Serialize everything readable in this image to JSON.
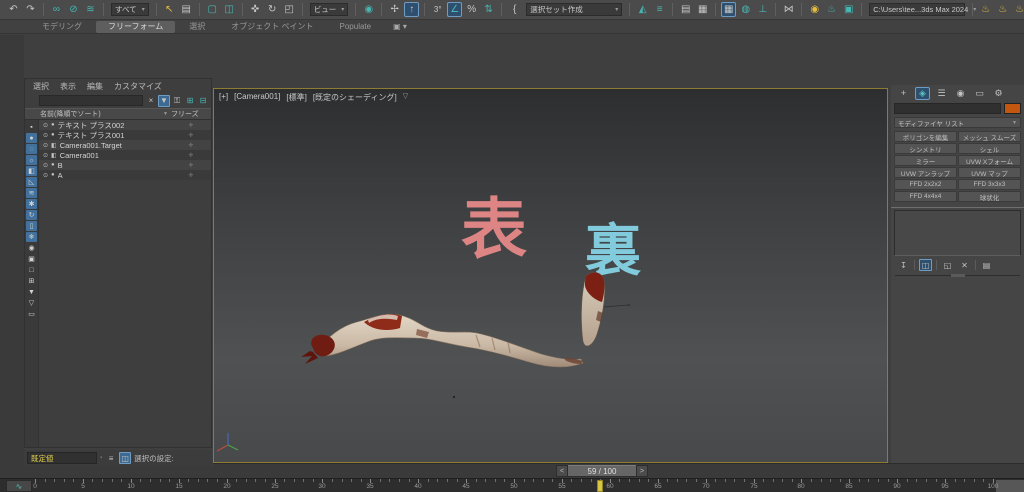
{
  "colors": {
    "accent_blue": "#2e4f6d",
    "teal": "#46b8b4",
    "yellow": "#e4bd3f",
    "swatch_orange": "#c4570f",
    "viewport_border": "#8f7c33",
    "front_text": "#dd8484",
    "back_text": "#82cbdc",
    "marker_yellow": "#d8c643"
  },
  "toolbar": {
    "groups": [
      {
        "items": [
          {
            "name": "undo-icon",
            "glyph": "↶"
          },
          {
            "name": "redo-icon",
            "glyph": "↷"
          }
        ]
      },
      {
        "items": [
          {
            "name": "select-and-link-icon",
            "glyph": "∞",
            "teal": true
          },
          {
            "name": "unlink-selection-icon",
            "glyph": "⊘",
            "teal": true
          },
          {
            "name": "bind-to-space-warp-icon",
            "glyph": "≋",
            "teal": true
          }
        ]
      },
      {
        "items": [
          {
            "name": "selection-filter-dropdown",
            "text": "すべて"
          }
        ]
      },
      {
        "items": [
          {
            "name": "select-object-icon",
            "glyph": "↖",
            "yellow": true
          },
          {
            "name": "select-by-name-icon",
            "glyph": "▤"
          }
        ]
      },
      {
        "items": [
          {
            "name": "rectangular-selection-region-icon",
            "glyph": "▢",
            "teal": true
          },
          {
            "name": "window-crossing-icon",
            "glyph": "◫",
            "teal": true
          }
        ]
      },
      {
        "items": [
          {
            "name": "select-and-move-icon",
            "glyph": "✜"
          },
          {
            "name": "select-and-rotate-icon",
            "glyph": "↻"
          },
          {
            "name": "select-and-scale-icon",
            "glyph": "◰"
          }
        ]
      },
      {
        "items": [
          {
            "name": "reference-coordinate-system-dropdown",
            "text": "ビュー"
          }
        ]
      },
      {
        "items": [
          {
            "name": "use-pivot-point-center-icon",
            "glyph": "◉",
            "teal": true
          }
        ]
      },
      {
        "items": [
          {
            "name": "select-and-manipulate-icon",
            "glyph": "✢"
          },
          {
            "name": "keyboard-shortcut-override-icon",
            "glyph": "↑",
            "active": true
          }
        ]
      },
      {
        "items": [
          {
            "name": "snaps-toggle-icon",
            "glyph": "3°"
          },
          {
            "name": "angle-snap-icon",
            "glyph": "∠",
            "teal": true,
            "active": true
          },
          {
            "name": "percent-snap-icon",
            "glyph": "%"
          },
          {
            "name": "spinner-snap-icon",
            "glyph": "⇅",
            "teal": true
          }
        ]
      },
      {
        "items": [
          {
            "name": "edit-named-selection-sets-icon",
            "glyph": "{"
          },
          {
            "name": "named-selection-sets-dropdown",
            "text": "選択セット作成",
            "wide": true
          }
        ]
      },
      {
        "items": [
          {
            "name": "mirror-icon",
            "glyph": "◭",
            "teal": true
          },
          {
            "name": "align-icon",
            "glyph": "≡",
            "teal": true
          }
        ]
      },
      {
        "items": [
          {
            "name": "toggle-scene-explorer-icon",
            "glyph": "▤"
          },
          {
            "name": "toggle-layer-explorer-icon",
            "glyph": "▦"
          }
        ]
      },
      {
        "items": [
          {
            "name": "viewport-layout-tabs-icon",
            "glyph": "▦",
            "active": true
          },
          {
            "name": "slate-material-editor-icon",
            "glyph": "◍",
            "teal": true
          },
          {
            "name": "curve-editor-icon",
            "glyph": "⊥",
            "teal": true
          }
        ]
      },
      {
        "items": [
          {
            "name": "schematic-view-icon",
            "glyph": "⋈"
          }
        ]
      },
      {
        "items": [
          {
            "name": "material-editor-icon",
            "glyph": "◉",
            "yellow": true
          },
          {
            "name": "render-setup-icon",
            "glyph": "♨",
            "teal": true
          },
          {
            "name": "rendered-frame-window-icon",
            "glyph": "▣",
            "teal": true
          }
        ]
      },
      {
        "items": [
          {
            "name": "project-folder-dropdown",
            "text": "C:\\Users\\tee...3ds Max 2024",
            "wide": true
          }
        ]
      },
      {
        "items": [
          {
            "name": "batch-render-icon",
            "glyph": "♨",
            "yellow": true
          },
          {
            "name": "render-to-texture-icon",
            "glyph": "♨",
            "yellow": true
          },
          {
            "name": "render-iterative-icon",
            "glyph": "♨",
            "yellow": true
          },
          {
            "name": "render-production-icon",
            "glyph": "♨",
            "yellow": true
          }
        ]
      },
      {
        "items": [
          {
            "name": "state-sets-clock-icon",
            "glyph": "◷",
            "active": true
          },
          {
            "name": "check-circle-icon",
            "glyph": "✔",
            "teal": true
          },
          {
            "name": "shutter-circle-icon",
            "glyph": "◎"
          }
        ]
      }
    ]
  },
  "ribbon": {
    "tabs": [
      {
        "name": "tab-modeling",
        "label": "モデリング"
      },
      {
        "name": "tab-freeform",
        "label": "フリーフォーム",
        "active": true
      },
      {
        "name": "tab-selection",
        "label": "選択"
      },
      {
        "name": "tab-object-paint",
        "label": "オブジェクト ペイント"
      },
      {
        "name": "tab-populate",
        "label": "Populate"
      }
    ],
    "config_icon_glyph": "▣",
    "config_arrow": "▾"
  },
  "scene_explorer": {
    "menus": [
      {
        "name": "menu-select",
        "label": "選択"
      },
      {
        "name": "menu-display",
        "label": "表示"
      },
      {
        "name": "menu-edit",
        "label": "編集"
      },
      {
        "name": "menu-customize",
        "label": "カスタマイズ"
      }
    ],
    "search_value": "",
    "search_buttons": [
      {
        "name": "clear-search-icon",
        "glyph": "×"
      },
      {
        "name": "search-filter-icon",
        "glyph": "▼",
        "on": true
      },
      {
        "name": "lock-explorer-icon",
        "glyph": "⚿"
      },
      {
        "name": "expand-all-icon",
        "glyph": "⊞",
        "teal": true
      },
      {
        "name": "collapse-all-icon",
        "glyph": "⊟",
        "teal": true
      }
    ],
    "name_column": "名前(降順でソート)",
    "sort_indicator": "▼",
    "freeze_column": "フリーズ",
    "filter_strip": [
      {
        "name": "explorer-options-icon",
        "glyph": "▪",
        "on": false
      },
      {
        "name": "filter-geometry-icon",
        "glyph": "●",
        "on": true
      },
      {
        "name": "filter-shapes-icon",
        "glyph": "◌",
        "on": true
      },
      {
        "name": "filter-lights-icon",
        "glyph": "☼",
        "on": true
      },
      {
        "name": "filter-cameras-icon",
        "glyph": "◧",
        "on": true
      },
      {
        "name": "filter-helpers-icon",
        "glyph": "◺",
        "on": true
      },
      {
        "name": "filter-space-warps-icon",
        "glyph": "≋",
        "on": true
      },
      {
        "name": "filter-particles-icon",
        "glyph": "✱",
        "on": true
      },
      {
        "name": "filter-bones-icon",
        "glyph": "↻",
        "on": true
      },
      {
        "name": "filter-containers-icon",
        "glyph": "▯",
        "on": true
      },
      {
        "name": "filter-frozen-icon",
        "glyph": "❄",
        "on": true
      },
      {
        "name": "toggle-hidden-icon",
        "glyph": "◉",
        "on": false
      },
      {
        "name": "display-influences-icon",
        "glyph": "▣",
        "on": false
      },
      {
        "name": "show-selected-icon",
        "glyph": "□",
        "on": false
      },
      {
        "name": "show-single-icon",
        "glyph": "⊞",
        "on": false
      },
      {
        "name": "pick-filter-icon",
        "glyph": "▼",
        "on": false
      },
      {
        "name": "filter-funnel-icon",
        "glyph": "▽",
        "on": false
      },
      {
        "name": "container-bucket-icon",
        "glyph": "▭",
        "on": false
      }
    ],
    "rows": [
      {
        "name": "テキスト プラス002",
        "type": "geometry"
      },
      {
        "name": "テキスト プラス001",
        "type": "geometry"
      },
      {
        "name": "Camera001.Target",
        "type": "camera"
      },
      {
        "name": "Camera001",
        "type": "camera"
      },
      {
        "name": "B",
        "type": "geometry"
      },
      {
        "name": "A",
        "type": "geometry"
      }
    ],
    "row_icons": {
      "eye": "⊙",
      "geometry": "●",
      "camera": "◧",
      "freeze": "✛"
    }
  },
  "viewport": {
    "label_segments": [
      "[+]",
      "[Camera001]",
      "[標準]",
      "[既定のシェーディング]"
    ],
    "filter_icon_glyph": "▽",
    "annotations": [
      {
        "name": "text-object-front",
        "text": "表",
        "color": "#dd8484"
      },
      {
        "name": "text-object-back",
        "text": "裏",
        "color": "#82cbdc"
      }
    ]
  },
  "command_panel": {
    "tabs": [
      {
        "name": "cp-tab-create",
        "glyph": "+"
      },
      {
        "name": "cp-tab-modify",
        "glyph": "◈",
        "active": true
      },
      {
        "name": "cp-tab-hierarchy",
        "glyph": "☰"
      },
      {
        "name": "cp-tab-motion",
        "glyph": "◉"
      },
      {
        "name": "cp-tab-display",
        "glyph": "▭"
      },
      {
        "name": "cp-tab-utilities",
        "glyph": "⚙"
      }
    ],
    "object_name_value": "",
    "color_swatch": "#c4570f",
    "modifier_list_label": "モディファイヤ リスト",
    "modifier_buttons": [
      {
        "name": "edit-poly-button",
        "label": "ポリゴンを編集"
      },
      {
        "name": "mesh-smooth-button",
        "label": "メッシュ スムーズ"
      },
      {
        "name": "symmetry-button",
        "label": "シンメトリ"
      },
      {
        "name": "shell-button",
        "label": "シェル"
      },
      {
        "name": "mirror-button",
        "label": "ミラー"
      },
      {
        "name": "uvw-xform-button",
        "label": "UVW Xフォーム"
      },
      {
        "name": "unwrap-uvw-button",
        "label": "UVW アンラップ"
      },
      {
        "name": "uvw-map-button",
        "label": "UVW マップ"
      },
      {
        "name": "ffd-2x2x2-button",
        "label": "FFD 2x2x2"
      },
      {
        "name": "ffd-3x3x3-button",
        "label": "FFD 3x3x3"
      },
      {
        "name": "ffd-4x4x4-button",
        "label": "FFD 4x4x4"
      },
      {
        "name": "spherify-button",
        "label": "球状化"
      }
    ],
    "stack_controls": [
      {
        "name": "pin-stack-icon",
        "glyph": "↧"
      },
      {
        "name": "show-end-result-icon",
        "glyph": "◫",
        "active": true
      },
      {
        "name": "make-unique-icon",
        "glyph": "◱"
      },
      {
        "name": "remove-modifier-icon",
        "glyph": "✕"
      },
      {
        "name": "configure-modifier-sets-icon",
        "glyph": "▤"
      }
    ]
  },
  "status_bar": {
    "preset_value": "既定値",
    "icons": [
      {
        "name": "sync-icon",
        "glyph": "≡"
      },
      {
        "name": "lock-selection-icon",
        "glyph": "◫",
        "active": true
      }
    ],
    "settings_label": "選択の設定:"
  },
  "timeline": {
    "current_frame": 59,
    "total_frames": 100,
    "slider_label": "59 / 100",
    "prev_button": "<",
    "next_button": ">",
    "tick_start": 0,
    "tick_end": 100,
    "label_step": 5,
    "curve_editor_button_glyph": "∿"
  }
}
